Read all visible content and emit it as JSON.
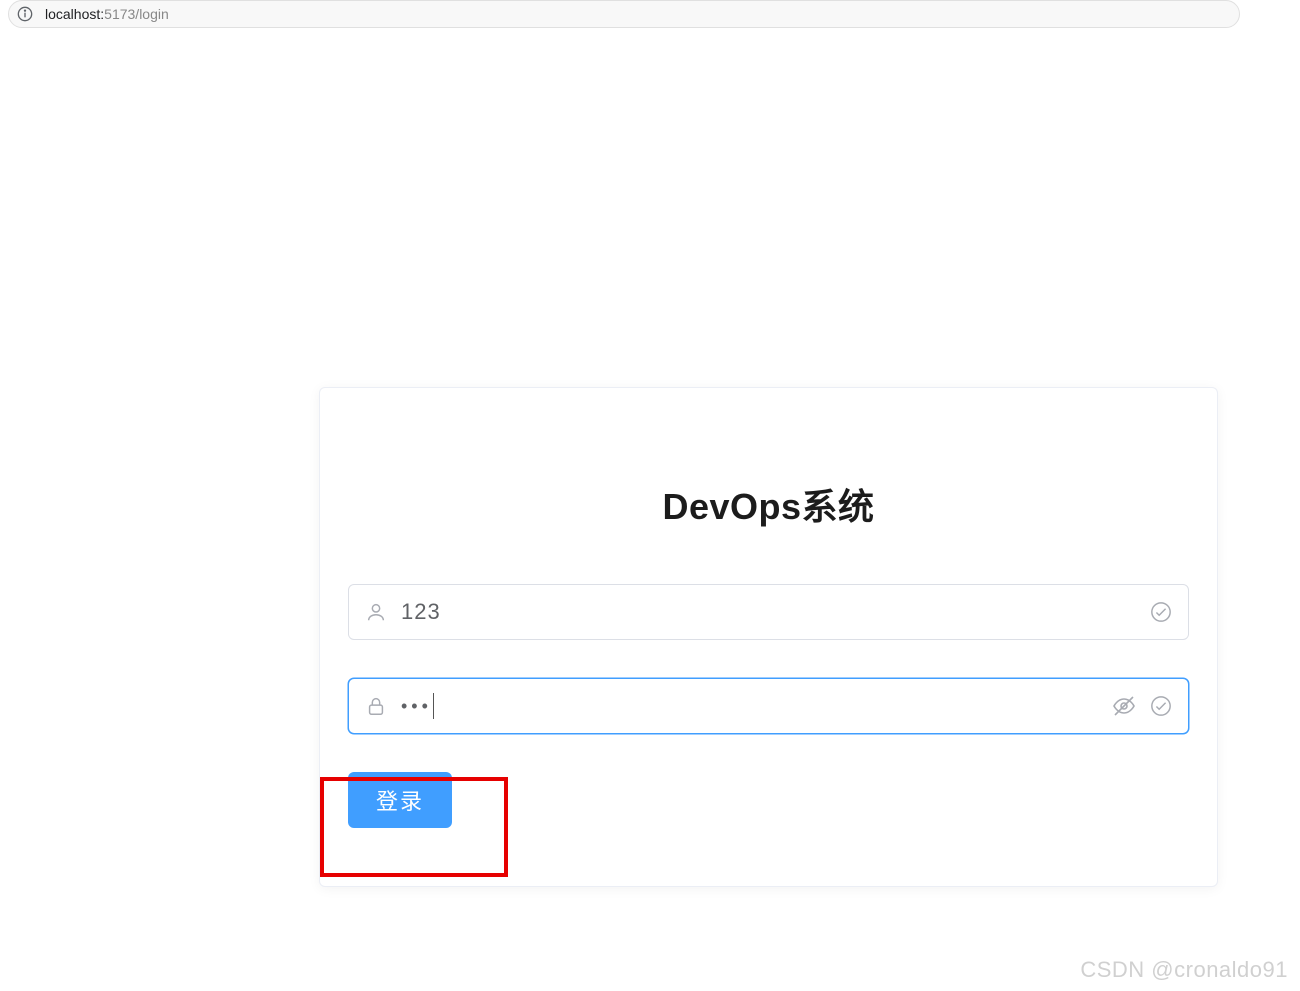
{
  "address_bar": {
    "host": "localhost:",
    "path": "5173/login"
  },
  "login": {
    "title": "DevOps系统",
    "username_value": "123",
    "password_value": "•••",
    "submit_label": "登录"
  },
  "watermark": "CSDN @cronaldo91"
}
